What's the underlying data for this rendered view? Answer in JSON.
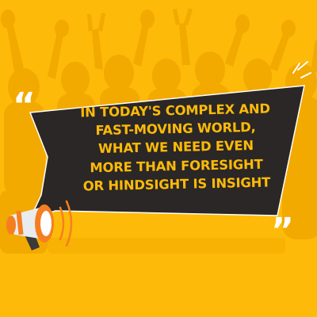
{
  "colors": {
    "background": "#FDBA08",
    "crowd_silhouette": "#F2A900",
    "bubble": "#2A2726",
    "text": "#FDBA08",
    "quote_marks": "#FFFFFF",
    "megaphone_body": "#E9ECEF",
    "megaphone_accent": "#F57F20"
  },
  "icons": {
    "megaphone": "megaphone-icon",
    "open_quote": "open-quote-icon",
    "close_quote": "close-quote-icon"
  },
  "quote": {
    "lines": [
      "IN TODAY'S COMPLEX AND",
      "FAST-MOVING WORLD,",
      "WHAT WE NEED EVEN",
      "MORE THAN FORESIGHT",
      "OR HINDSIGHT IS INSIGHT"
    ]
  }
}
